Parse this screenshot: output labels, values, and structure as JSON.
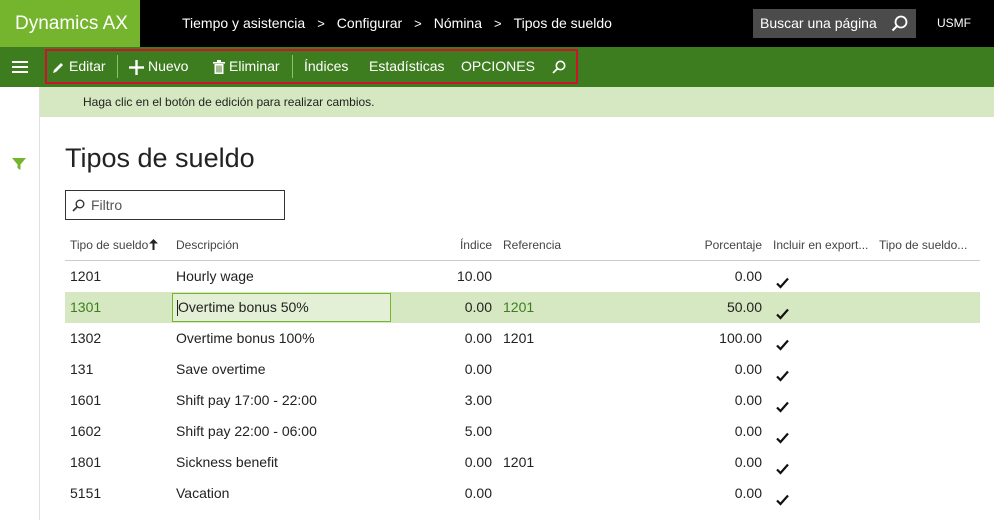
{
  "app": {
    "title": "Dynamics AX",
    "company": "USMF"
  },
  "breadcrumb": [
    "Tiempo y asistencia",
    "Configurar",
    "Nómina",
    "Tipos de sueldo"
  ],
  "search": {
    "placeholder": "Buscar una página"
  },
  "toolbar": {
    "edit": "Editar",
    "new": "Nuevo",
    "delete": "Eliminar",
    "indices": "Índices",
    "stats": "Estadísticas",
    "options": "OPCIONES"
  },
  "message": "Haga clic en el botón de edición para realizar cambios.",
  "page": {
    "title": "Tipos de sueldo",
    "filter_placeholder": "Filtro"
  },
  "grid": {
    "columns": {
      "code": "Tipo de sueldo",
      "desc": "Descripción",
      "index": "Índice",
      "ref": "Referencia",
      "pct": "Porcentaje",
      "export": "Incluir en export...",
      "type": "Tipo de sueldo..."
    },
    "rows": [
      {
        "code": "1201",
        "desc": "Hourly wage",
        "index": "10.00",
        "ref": "",
        "pct": "0.00"
      },
      {
        "code": "1301",
        "desc": "Overtime bonus 50%",
        "index": "0.00",
        "ref": "1201",
        "pct": "50.00"
      },
      {
        "code": "1302",
        "desc": "Overtime bonus 100%",
        "index": "0.00",
        "ref": "1201",
        "pct": "100.00"
      },
      {
        "code": "131",
        "desc": "Save overtime",
        "index": "0.00",
        "ref": "",
        "pct": "0.00"
      },
      {
        "code": "1601",
        "desc": "Shift pay 17:00 - 22:00",
        "index": "3.00",
        "ref": "",
        "pct": "0.00"
      },
      {
        "code": "1602",
        "desc": "Shift pay 22:00 - 06:00",
        "index": "5.00",
        "ref": "",
        "pct": "0.00"
      },
      {
        "code": "1801",
        "desc": "Sickness benefit",
        "index": "0.00",
        "ref": "1201",
        "pct": "0.00"
      },
      {
        "code": "5151",
        "desc": "Vacation",
        "index": "0.00",
        "ref": "",
        "pct": "0.00"
      }
    ]
  }
}
